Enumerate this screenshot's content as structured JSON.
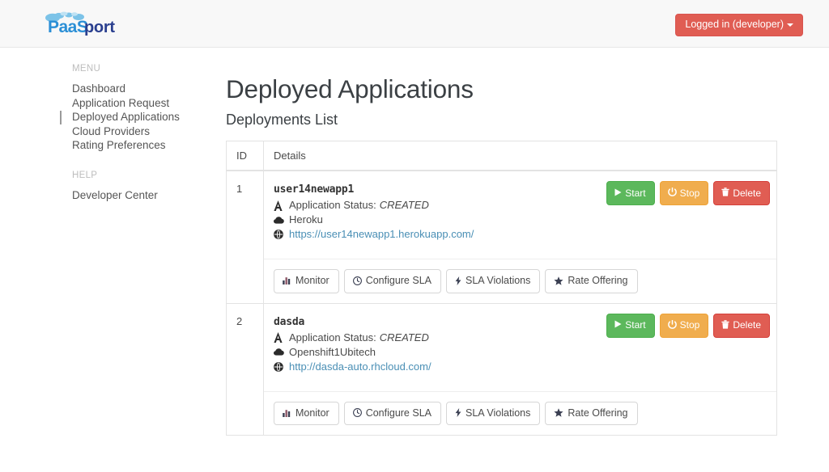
{
  "topbar": {
    "brand_text_1": "PaaS",
    "brand_text_2": "port",
    "brand_color_1": "#2b8fd6",
    "brand_color_2": "#2a3f8f",
    "login_label": "Logged in (developer)",
    "login_color": "#e05d53"
  },
  "sidebar": {
    "menu_heading": "MENU",
    "help_heading": "HELP",
    "items": [
      {
        "label": "Dashboard",
        "active": false
      },
      {
        "label": "Application Request",
        "active": false
      },
      {
        "label": "Deployed Applications",
        "active": true
      },
      {
        "label": "Cloud Providers",
        "active": false
      },
      {
        "label": "Rating Preferences",
        "active": false
      }
    ],
    "help_items": [
      {
        "label": "Developer Center",
        "active": false
      }
    ]
  },
  "main": {
    "page_title": "Deployed Applications",
    "subtitle": "Deployments List"
  },
  "table": {
    "columns": [
      "ID",
      "Details"
    ],
    "status_label": "Application Status:",
    "rows": [
      {
        "id": "1",
        "app_name": "user14newapp1",
        "status": "CREATED",
        "provider": "Heroku",
        "url": "https://user14newapp1.herokuapp.com/",
        "state_buttons": [
          {
            "label": "Start",
            "icon": "play-icon",
            "color": "#5cb85c"
          },
          {
            "label": "Stop",
            "icon": "power-icon",
            "color": "#f0ad4e"
          },
          {
            "label": "Delete",
            "icon": "trash-icon",
            "color": "#e05d53"
          }
        ],
        "tool_buttons": [
          {
            "label": "Monitor",
            "icon": "bar-chart-icon"
          },
          {
            "label": "Configure SLA",
            "icon": "clock-icon"
          },
          {
            "label": "SLA Violations",
            "icon": "bolt-icon"
          },
          {
            "label": "Rate Offering",
            "icon": "star-icon"
          }
        ]
      },
      {
        "id": "2",
        "app_name": "dasda",
        "status": "CREATED",
        "provider": "Openshift1Ubitech",
        "url": "http://dasda-auto.rhcloud.com/",
        "state_buttons": [
          {
            "label": "Start",
            "icon": "play-icon",
            "color": "#5cb85c"
          },
          {
            "label": "Stop",
            "icon": "power-icon",
            "color": "#f0ad4e"
          },
          {
            "label": "Delete",
            "icon": "trash-icon",
            "color": "#e05d53"
          }
        ],
        "tool_buttons": [
          {
            "label": "Monitor",
            "icon": "bar-chart-icon"
          },
          {
            "label": "Configure SLA",
            "icon": "clock-icon"
          },
          {
            "label": "SLA Violations",
            "icon": "bolt-icon"
          },
          {
            "label": "Rate Offering",
            "icon": "star-icon"
          }
        ]
      }
    ]
  }
}
